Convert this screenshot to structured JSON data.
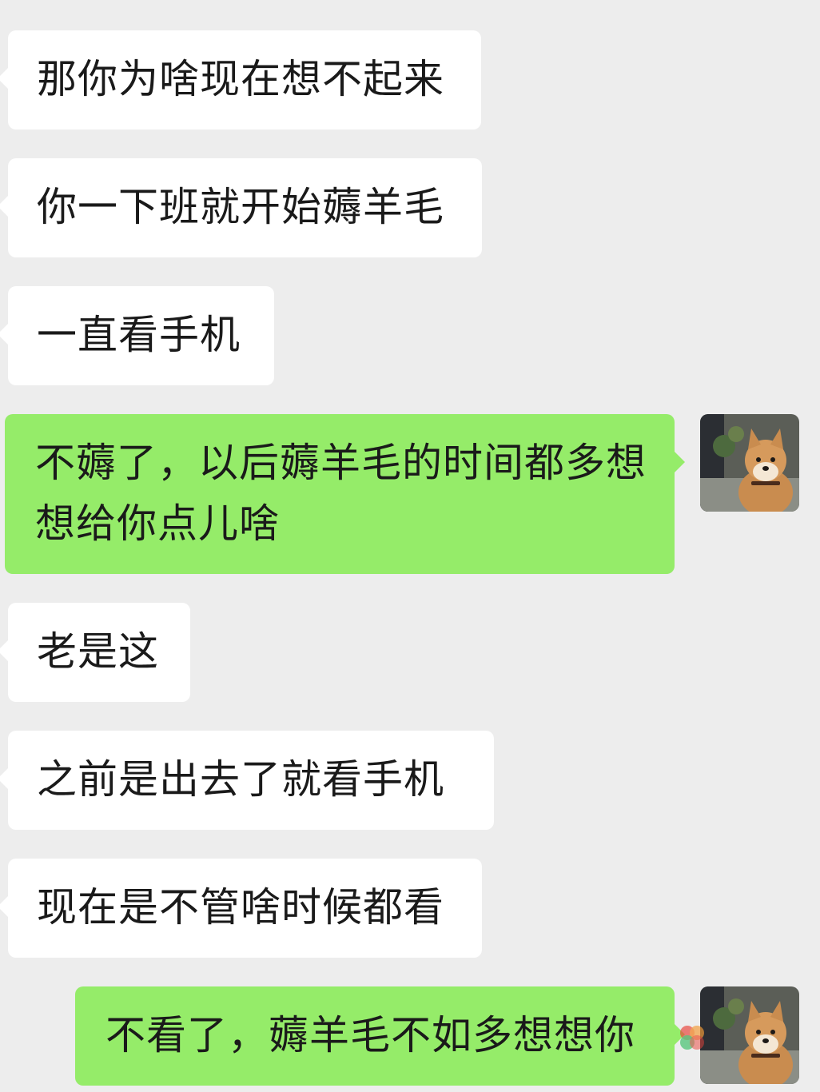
{
  "colors": {
    "background": "#ededed",
    "received_bubble": "#ffffff",
    "sent_bubble": "#95ec69",
    "text": "#1a1a1a"
  },
  "messages": [
    {
      "side": "left",
      "text": "那你为啥现在想不起来"
    },
    {
      "side": "left",
      "text": "你一下班就开始薅羊毛"
    },
    {
      "side": "left",
      "text": "一直看手机"
    },
    {
      "side": "right",
      "line1": "不薅了，以后薅羊毛的时间都多想",
      "line2": "想给你点儿啥",
      "avatar": "shiba-dog-avatar"
    },
    {
      "side": "left",
      "text": "老是这"
    },
    {
      "side": "left",
      "text": "之前是出去了就看手机"
    },
    {
      "side": "left",
      "text": "现在是不管啥时候都看"
    },
    {
      "side": "right",
      "text": "不看了，薅羊毛不如多想想你",
      "avatar": "shiba-dog-avatar"
    }
  ]
}
